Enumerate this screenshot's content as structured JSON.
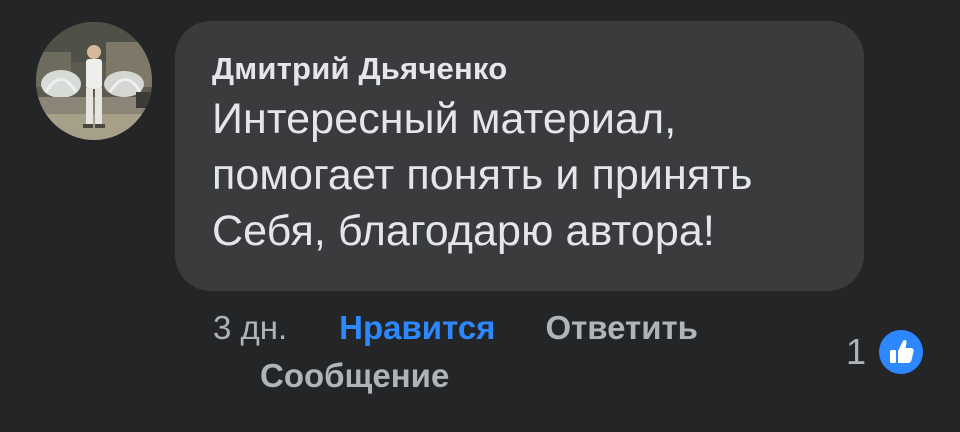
{
  "comment": {
    "author": "Дмитрий Дьяченко",
    "text": "Интересный материал, помогает понять и принять Себя, благодарю автора!",
    "timestamp": "3 дн.",
    "like_label": "Нравится",
    "reply_label": "Ответить",
    "message_label": "Сообщение",
    "reaction_count": "1",
    "reaction_icon": "thumbs-up-icon"
  },
  "colors": {
    "background": "#242526",
    "bubble": "#3a3b3c",
    "text_primary": "#e4e6eb",
    "text_secondary": "#b0b3b8",
    "accent_blue": "#2d88ff"
  }
}
